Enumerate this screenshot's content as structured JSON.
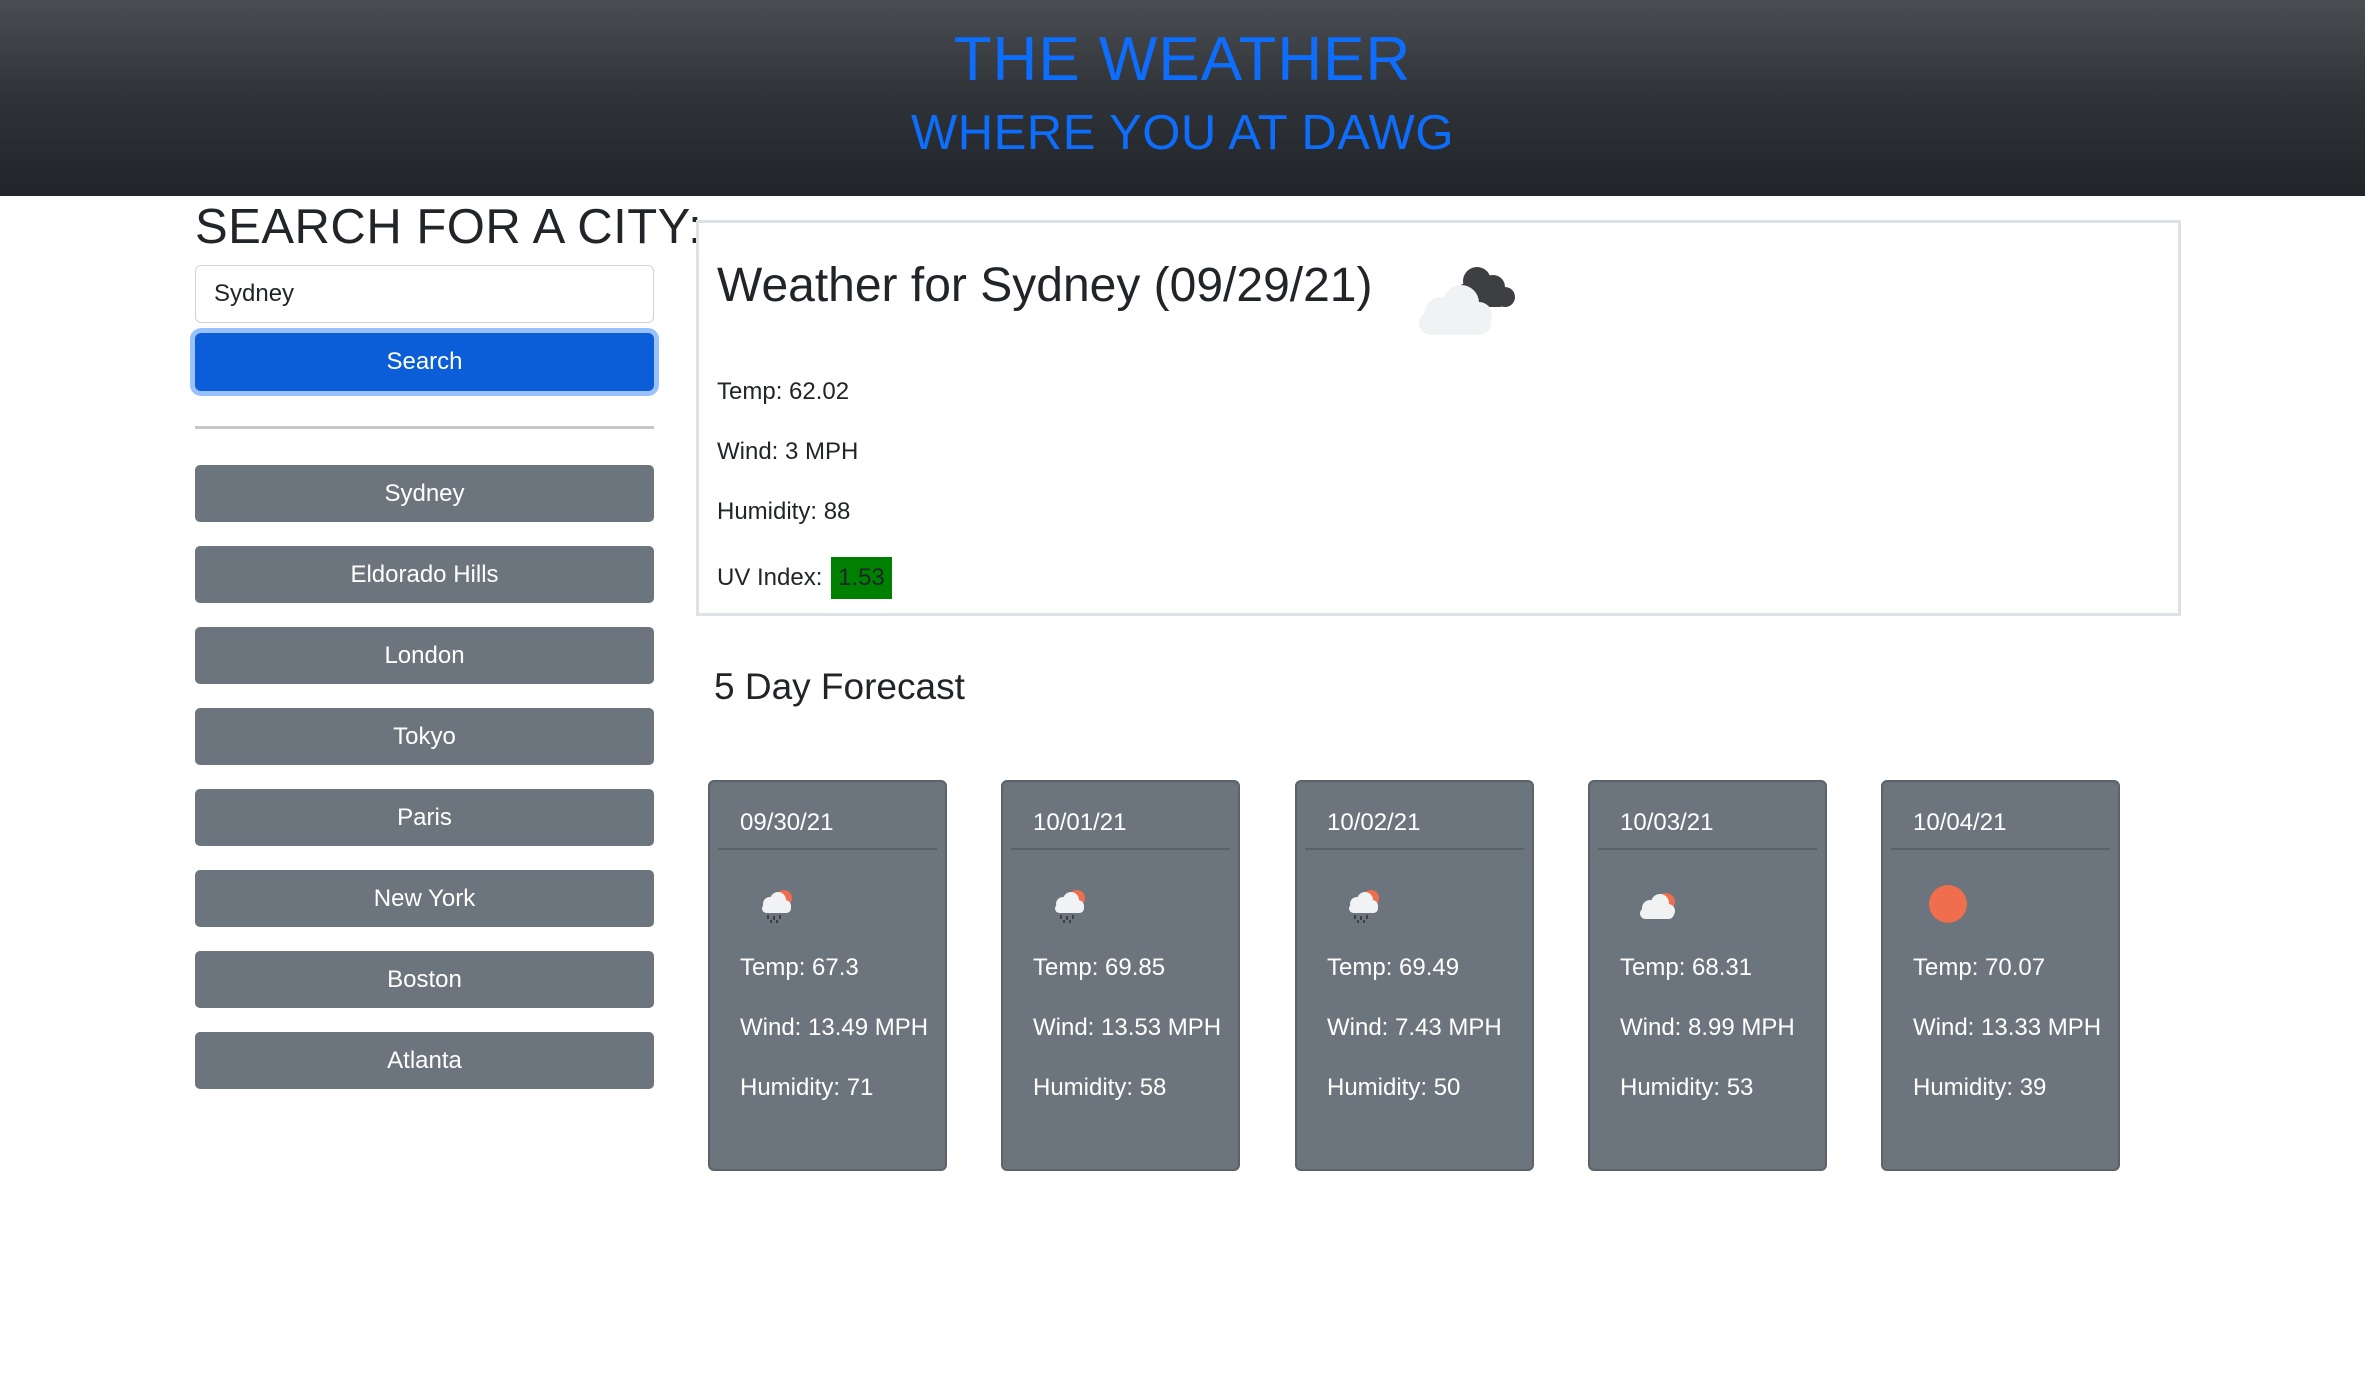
{
  "header": {
    "title": "THE WEATHER",
    "subtitle": "WHERE YOU AT DAWG"
  },
  "sidebar": {
    "heading": "SEARCH FOR A CITY:",
    "search_value": "Sydney",
    "search_button": "Search",
    "cities": [
      "Sydney",
      "Eldorado Hills",
      "London",
      "Tokyo",
      "Paris",
      "New York",
      "Boston",
      "Atlanta"
    ]
  },
  "current": {
    "title": "Weather for Sydney (09/29/21)",
    "icon": "broken-clouds-icon",
    "temp": "Temp: 62.02",
    "wind": "Wind: 3 MPH",
    "humidity": "Humidity: 88",
    "uv_label": "UV Index:",
    "uv_value": "1.53",
    "uv_color": "#008000"
  },
  "forecast": {
    "heading": "5 Day Forecast",
    "days": [
      {
        "date": "09/30/21",
        "icon": "rain-sun-icon",
        "temp": "Temp: 67.3",
        "wind": "Wind: 13.49 MPH",
        "humidity": "Humidity: 71"
      },
      {
        "date": "10/01/21",
        "icon": "rain-sun-icon",
        "temp": "Temp: 69.85",
        "wind": "Wind: 13.53 MPH",
        "humidity": "Humidity: 58"
      },
      {
        "date": "10/02/21",
        "icon": "rain-sun-icon",
        "temp": "Temp: 69.49",
        "wind": "Wind: 7.43 MPH",
        "humidity": "Humidity: 50"
      },
      {
        "date": "10/03/21",
        "icon": "cloud-sun-icon",
        "temp": "Temp: 68.31",
        "wind": "Wind: 8.99 MPH",
        "humidity": "Humidity: 53"
      },
      {
        "date": "10/04/21",
        "icon": "sun-icon",
        "temp": "Temp: 70.07",
        "wind": "Wind: 13.33 MPH",
        "humidity": "Humidity: 39"
      }
    ]
  },
  "colors": {
    "accent": "#0d6efd",
    "button": "#6c757d",
    "sun": "#ee6e4d"
  }
}
